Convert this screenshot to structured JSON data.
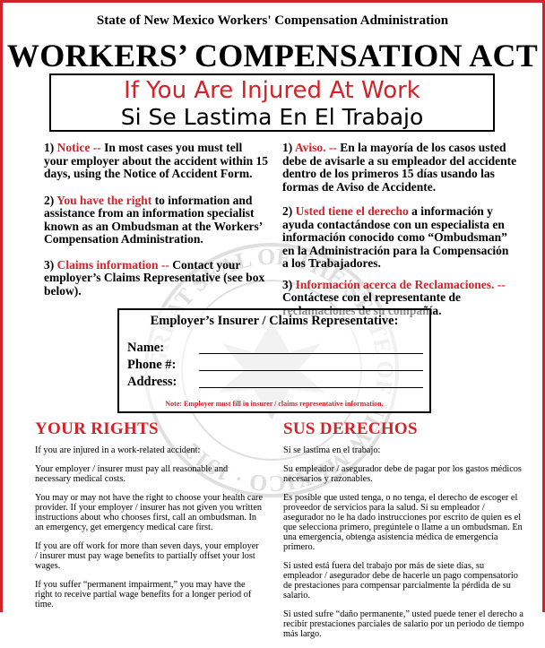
{
  "header": {
    "agency": "State of New Mexico Workers' Compensation Administration",
    "title": "WORKERS’ COMPENSATION ACT"
  },
  "banner": {
    "english": "If You Are Injured At Work",
    "spanish": "Si Se Lastima En El Trabajo"
  },
  "english_items": [
    {
      "lead": "1)",
      "highlight": "Notice --",
      "text": " In most cases you must tell your employer about the accident within 15 days, using the Notice of Accident Form."
    },
    {
      "lead": "2)",
      "highlight": "You have the right",
      "text": " to information and assistance from an information specialist known as an Ombudsman at the Workers’ Compensation Administration."
    },
    {
      "lead": "3)",
      "highlight": "Claims information --",
      "text": " Contact your employer’s Claims Representative (see box below)."
    }
  ],
  "spanish_items": [
    {
      "lead": "1)",
      "highlight": "Aviso. --",
      "text": " En la mayoría de los casos usted debe de avisarle a su empleador del accidente dentro de los primeros 15 días usando las formas de Aviso de Accidente."
    },
    {
      "lead": "2)",
      "highlight": "Usted tiene el derecho",
      "text": " a información y ayuda contactándose con un especialista en información conocido como “Ombudsman” en la Administración para la Compensación a los Trabajadores."
    },
    {
      "lead": "3)",
      "highlight": "Información acerca de Reclamaciones. --",
      "text": " Contáctese con el representante de reclamaciones de su compañía."
    }
  ],
  "claims_box": {
    "heading": "Employer’s Insurer / Claims Representative:",
    "fields": [
      "Name:",
      "Phone #:",
      "Address:"
    ],
    "note": "Note: Employer must fill in insurer / claims representative information."
  },
  "seal_text": "GREAT SEAL OF THE STATE OF NEW MEXICO · 1912",
  "your_rights": {
    "title": "YOUR RIGHTS",
    "paragraphs": [
      "If you are injured in a work-related accident:",
      "Your employer / insurer must pay all reasonable and necessary medical costs.",
      "You may or may not have the right to choose your health care provider. If your employer / insurer has not given you written instructions about who chooses first, call an ombudsman. In an emergency, get emergency medical care first.",
      "If you are off work for more than seven days, your employer / insurer must pay wage benefits to partially offset your lost wages.",
      "If you suffer “permanent impairment,” you may have the right to receive partial wage benefits for a longer period of time."
    ]
  },
  "sus_derechos": {
    "title": "SUS DERECHOS",
    "paragraphs": [
      "Si se lastima en el trabajo:",
      "Su empleador / asegurador debe de pagar por los gastos médicos necesarios y razonables.",
      "Es posible que usted tenga, o no tenga, el derecho de escoger el proveedor de servicios para la salud. Si su empleador / asegurador no le ha dado instrucciones por escrito de quien es el que selecciona primero, pregúntele o llame a un ombudsman. En una emergencia, obtenga asistencia médica de emergencia primero.",
      "Si usted está fuera del trabajo por más de siete días, su empleador / asegurador debe de hacerle un pago compensatorio de prestaciones para compensar parcialmente la pérdida de su salario.",
      "Si usted sufre “daño permanente,” usted puede tener el derecho a recibir prestaciones parciales de salario por un periodo de tiempo más largo."
    ]
  },
  "colors": {
    "accent": "#d2232a",
    "text": "#000000"
  }
}
